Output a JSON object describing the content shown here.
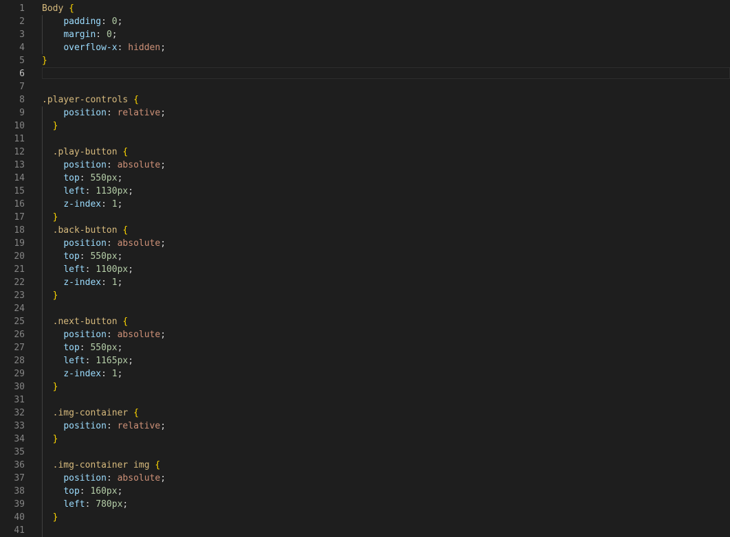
{
  "editor": {
    "language": "css",
    "current_line": 6,
    "colors": {
      "background": "#1e1e1e",
      "line_number": "#858585",
      "line_number_active": "#c6c6c6",
      "selector": "#d7ba7d",
      "brace": "#ffd700",
      "property": "#9cdcfe",
      "value": "#ce9178",
      "number": "#b5cea8",
      "punctuation": "#d4d4d4"
    },
    "lines": [
      {
        "n": "1",
        "tokens": [
          [
            "sel",
            "Body "
          ],
          [
            "br",
            "{"
          ]
        ]
      },
      {
        "n": "2",
        "tokens": [
          [
            "ws",
            "    "
          ],
          [
            "prop",
            "padding"
          ],
          [
            "p",
            ": "
          ],
          [
            "num",
            "0"
          ],
          [
            "p",
            ";"
          ]
        ]
      },
      {
        "n": "3",
        "tokens": [
          [
            "ws",
            "    "
          ],
          [
            "prop",
            "margin"
          ],
          [
            "p",
            ": "
          ],
          [
            "num",
            "0"
          ],
          [
            "p",
            ";"
          ]
        ]
      },
      {
        "n": "4",
        "tokens": [
          [
            "ws",
            "    "
          ],
          [
            "prop",
            "overflow-x"
          ],
          [
            "p",
            ": "
          ],
          [
            "val",
            "hidden"
          ],
          [
            "p",
            ";"
          ]
        ]
      },
      {
        "n": "5",
        "tokens": [
          [
            "br",
            "}"
          ]
        ]
      },
      {
        "n": "6",
        "tokens": []
      },
      {
        "n": "7",
        "tokens": []
      },
      {
        "n": "8",
        "tokens": [
          [
            "sel",
            ".player-controls "
          ],
          [
            "br",
            "{"
          ]
        ]
      },
      {
        "n": "9",
        "tokens": [
          [
            "ws",
            "    "
          ],
          [
            "prop",
            "position"
          ],
          [
            "p",
            ": "
          ],
          [
            "val",
            "relative"
          ],
          [
            "p",
            ";"
          ]
        ]
      },
      {
        "n": "10",
        "tokens": [
          [
            "ws",
            "  "
          ],
          [
            "br",
            "}"
          ]
        ]
      },
      {
        "n": "11",
        "tokens": []
      },
      {
        "n": "12",
        "tokens": [
          [
            "ws",
            "  "
          ],
          [
            "sel",
            ".play-button "
          ],
          [
            "br",
            "{"
          ]
        ]
      },
      {
        "n": "13",
        "tokens": [
          [
            "ws",
            "    "
          ],
          [
            "prop",
            "position"
          ],
          [
            "p",
            ": "
          ],
          [
            "val",
            "absolute"
          ],
          [
            "p",
            ";"
          ]
        ]
      },
      {
        "n": "14",
        "tokens": [
          [
            "ws",
            "    "
          ],
          [
            "prop",
            "top"
          ],
          [
            "p",
            ": "
          ],
          [
            "num",
            "550px"
          ],
          [
            "p",
            ";"
          ]
        ]
      },
      {
        "n": "15",
        "tokens": [
          [
            "ws",
            "    "
          ],
          [
            "prop",
            "left"
          ],
          [
            "p",
            ": "
          ],
          [
            "num",
            "1130px"
          ],
          [
            "p",
            ";"
          ]
        ]
      },
      {
        "n": "16",
        "tokens": [
          [
            "ws",
            "    "
          ],
          [
            "prop",
            "z-index"
          ],
          [
            "p",
            ": "
          ],
          [
            "num",
            "1"
          ],
          [
            "p",
            ";"
          ]
        ]
      },
      {
        "n": "17",
        "tokens": [
          [
            "ws",
            "  "
          ],
          [
            "br",
            "}"
          ]
        ]
      },
      {
        "n": "18",
        "tokens": [
          [
            "ws",
            "  "
          ],
          [
            "sel",
            ".back-button "
          ],
          [
            "br",
            "{"
          ]
        ]
      },
      {
        "n": "19",
        "tokens": [
          [
            "ws",
            "    "
          ],
          [
            "prop",
            "position"
          ],
          [
            "p",
            ": "
          ],
          [
            "val",
            "absolute"
          ],
          [
            "p",
            ";"
          ]
        ]
      },
      {
        "n": "20",
        "tokens": [
          [
            "ws",
            "    "
          ],
          [
            "prop",
            "top"
          ],
          [
            "p",
            ": "
          ],
          [
            "num",
            "550px"
          ],
          [
            "p",
            ";"
          ]
        ]
      },
      {
        "n": "21",
        "tokens": [
          [
            "ws",
            "    "
          ],
          [
            "prop",
            "left"
          ],
          [
            "p",
            ": "
          ],
          [
            "num",
            "1100px"
          ],
          [
            "p",
            ";"
          ]
        ]
      },
      {
        "n": "22",
        "tokens": [
          [
            "ws",
            "    "
          ],
          [
            "prop",
            "z-index"
          ],
          [
            "p",
            ": "
          ],
          [
            "num",
            "1"
          ],
          [
            "p",
            ";"
          ]
        ]
      },
      {
        "n": "23",
        "tokens": [
          [
            "ws",
            "  "
          ],
          [
            "br",
            "}"
          ]
        ]
      },
      {
        "n": "24",
        "tokens": []
      },
      {
        "n": "25",
        "tokens": [
          [
            "ws",
            "  "
          ],
          [
            "sel",
            ".next-button "
          ],
          [
            "br",
            "{"
          ]
        ]
      },
      {
        "n": "26",
        "tokens": [
          [
            "ws",
            "    "
          ],
          [
            "prop",
            "position"
          ],
          [
            "p",
            ": "
          ],
          [
            "val",
            "absolute"
          ],
          [
            "p",
            ";"
          ]
        ]
      },
      {
        "n": "27",
        "tokens": [
          [
            "ws",
            "    "
          ],
          [
            "prop",
            "top"
          ],
          [
            "p",
            ": "
          ],
          [
            "num",
            "550px"
          ],
          [
            "p",
            ";"
          ]
        ]
      },
      {
        "n": "28",
        "tokens": [
          [
            "ws",
            "    "
          ],
          [
            "prop",
            "left"
          ],
          [
            "p",
            ": "
          ],
          [
            "num",
            "1165px"
          ],
          [
            "p",
            ";"
          ]
        ]
      },
      {
        "n": "29",
        "tokens": [
          [
            "ws",
            "    "
          ],
          [
            "prop",
            "z-index"
          ],
          [
            "p",
            ": "
          ],
          [
            "num",
            "1"
          ],
          [
            "p",
            ";"
          ]
        ]
      },
      {
        "n": "30",
        "tokens": [
          [
            "ws",
            "  "
          ],
          [
            "br",
            "}"
          ]
        ]
      },
      {
        "n": "31",
        "tokens": []
      },
      {
        "n": "32",
        "tokens": [
          [
            "ws",
            "  "
          ],
          [
            "sel",
            ".img-container "
          ],
          [
            "br",
            "{"
          ]
        ]
      },
      {
        "n": "33",
        "tokens": [
          [
            "ws",
            "    "
          ],
          [
            "prop",
            "position"
          ],
          [
            "p",
            ": "
          ],
          [
            "val",
            "relative"
          ],
          [
            "p",
            ";"
          ]
        ]
      },
      {
        "n": "34",
        "tokens": [
          [
            "ws",
            "  "
          ],
          [
            "br",
            "}"
          ]
        ]
      },
      {
        "n": "35",
        "tokens": []
      },
      {
        "n": "36",
        "tokens": [
          [
            "ws",
            "  "
          ],
          [
            "sel",
            ".img-container img "
          ],
          [
            "br",
            "{"
          ]
        ]
      },
      {
        "n": "37",
        "tokens": [
          [
            "ws",
            "    "
          ],
          [
            "prop",
            "position"
          ],
          [
            "p",
            ": "
          ],
          [
            "val",
            "absolute"
          ],
          [
            "p",
            ";"
          ]
        ]
      },
      {
        "n": "38",
        "tokens": [
          [
            "ws",
            "    "
          ],
          [
            "prop",
            "top"
          ],
          [
            "p",
            ": "
          ],
          [
            "num",
            "160px"
          ],
          [
            "p",
            ";"
          ]
        ]
      },
      {
        "n": "39",
        "tokens": [
          [
            "ws",
            "    "
          ],
          [
            "prop",
            "left"
          ],
          [
            "p",
            ": "
          ],
          [
            "num",
            "780px"
          ],
          [
            "p",
            ";"
          ]
        ]
      },
      {
        "n": "40",
        "tokens": [
          [
            "ws",
            "  "
          ],
          [
            "br",
            "}"
          ]
        ]
      },
      {
        "n": "41",
        "tokens": []
      }
    ]
  }
}
